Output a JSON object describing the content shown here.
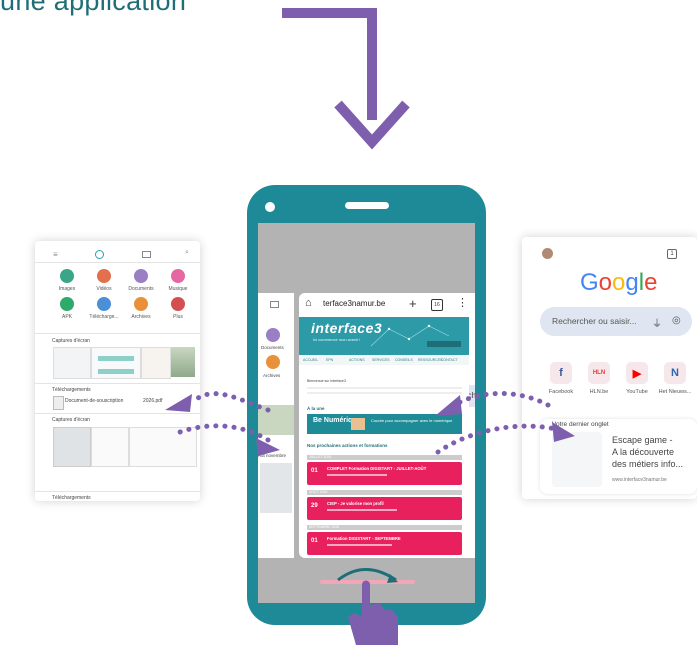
{
  "title": "une application",
  "colors": {
    "teal": "#1e8a97",
    "purple": "#7e5fae",
    "pink": "#e8215e"
  },
  "file_manager": {
    "categories": [
      {
        "label": "Images",
        "color": "#3aa588"
      },
      {
        "label": "Vidéos",
        "color": "#e2704c"
      },
      {
        "label": "Documents",
        "color": "#9a7fc4"
      },
      {
        "label": "Musique",
        "color": "#e567a0"
      },
      {
        "label": "APK",
        "color": "#2eaa6a"
      },
      {
        "label": "Télécharge...",
        "color": "#4a8fd8"
      },
      {
        "label": "Archives",
        "color": "#e9913a"
      },
      {
        "label": "Plus",
        "color": "#d45050"
      }
    ],
    "section1": "Captures d'écran",
    "section2": "Téléchargements",
    "download_name": "Document-de-souscription",
    "download_ext": "2026.pdf",
    "section3": "Captures d'écran",
    "section4": "Téléchargements"
  },
  "phone": {
    "side_labels": [
      "Documents",
      "Archives"
    ],
    "side_text": "Aut novembre",
    "browser": {
      "url": "terface3namur.be",
      "tab_count": "16",
      "logo": "interface3",
      "logo_sub": "Ici commence mon avenir!",
      "menu": [
        "ACCUEIL",
        "EPN",
        "ACTIONS",
        "SERVICES",
        "CONSEILS",
        "RESSOURCES",
        "CONTACT"
      ],
      "bienvenue": "Bienvenue sur Interface3",
      "a_la_une": "À la une",
      "banner_title": "Be Numérique",
      "banner_text": "Coudre pour accompagner avec le numérique",
      "agenda_title": "Nos prochaines actions et formations",
      "months": [
        "JUILLET 2026",
        "AOÛT 2026",
        "SEPTEMBRE 2026"
      ],
      "events": [
        {
          "day": "01",
          "title": "COMPLET Formation DIGISTART - JUILLET-AOÛT"
        },
        {
          "day": "29",
          "title": "CIEP - Je valorise mon profil"
        },
        {
          "day": "01",
          "title": "Formation DIGISTART - SEPTEMBRE"
        }
      ],
      "side_snippet": "cherch"
    }
  },
  "google": {
    "logo_letters": [
      {
        "ch": "G",
        "color": "#4285f4"
      },
      {
        "ch": "o",
        "color": "#ea4335"
      },
      {
        "ch": "o",
        "color": "#fbbc05"
      },
      {
        "ch": "g",
        "color": "#4285f4"
      },
      {
        "ch": "l",
        "color": "#34a853"
      },
      {
        "ch": "e",
        "color": "#ea4335"
      }
    ],
    "search_placeholder": "Rechercher ou saisir...",
    "tab_count": "1",
    "shortcuts": [
      {
        "label": "Facebook",
        "glyph": "f",
        "color": "#3b5998"
      },
      {
        "label": "HLN.be",
        "glyph": "HLN",
        "color": "#e23b3b"
      },
      {
        "label": "YouTube",
        "glyph": "▶",
        "color": "#ff0000"
      },
      {
        "label": "Het Nieuws...",
        "glyph": "N",
        "color": "#2966b8"
      }
    ],
    "last_tab_header": "Votre dernier onglet",
    "last_tab_lines": [
      "Escape game -",
      "A la découverte",
      "des métiers info..."
    ],
    "last_tab_domain": "www.interface3namur.be"
  }
}
